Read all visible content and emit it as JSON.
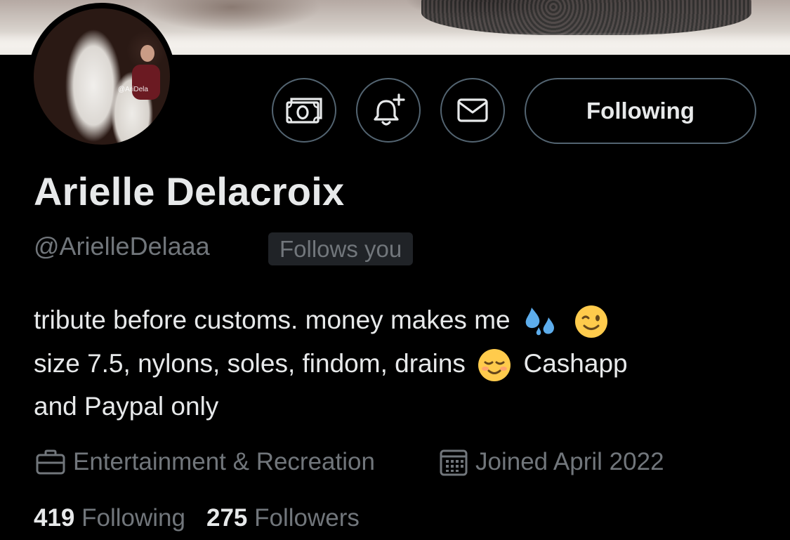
{
  "banner": {
    "description_icon": "banner-image"
  },
  "avatar": {
    "watermark": "@AriDela"
  },
  "actions": {
    "tip_icon": "money-icon",
    "notify_icon": "bell-plus-icon",
    "message_icon": "envelope-icon",
    "follow_label": "Following"
  },
  "profile": {
    "display_name": "Arielle Delacroix",
    "handle": "@ArielleDelaaa",
    "follows_you": "Follows you",
    "bio_line1_text": "tribute before customs. money makes me",
    "bio_line2_text": "size 7.5, nylons, soles, findom, drains",
    "bio_line2_tail": "Cashapp",
    "bio_line3_text": "and Paypal only",
    "category": "Entertainment & Recreation",
    "joined": "Joined April 2022",
    "following_count": "419",
    "following_label": "Following",
    "followers_count": "275",
    "followers_label": "Followers"
  },
  "colors": {
    "background": "#000000",
    "text_primary": "#e7e9ea",
    "text_secondary": "#71767b",
    "border": "#536471",
    "badge_bg": "#202327"
  }
}
